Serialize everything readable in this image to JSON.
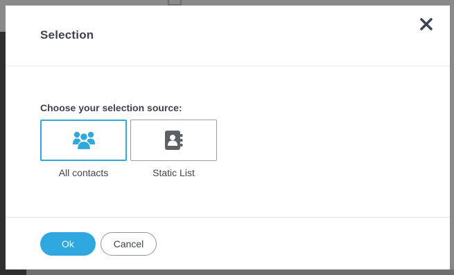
{
  "dialog": {
    "title": "Selection",
    "close_icon": "close-icon"
  },
  "body": {
    "source_label": "Choose your selection source:",
    "options": [
      {
        "label": "All contacts",
        "icon": "contacts-group-icon",
        "selected": true
      },
      {
        "label": "Static List",
        "icon": "address-book-icon",
        "selected": false
      }
    ]
  },
  "footer": {
    "ok_label": "Ok",
    "cancel_label": "Cancel"
  },
  "colors": {
    "accent": "#2ea8de",
    "text": "#3d4350",
    "icon_gray": "#5d6166",
    "border_gray": "#9a9da3"
  }
}
